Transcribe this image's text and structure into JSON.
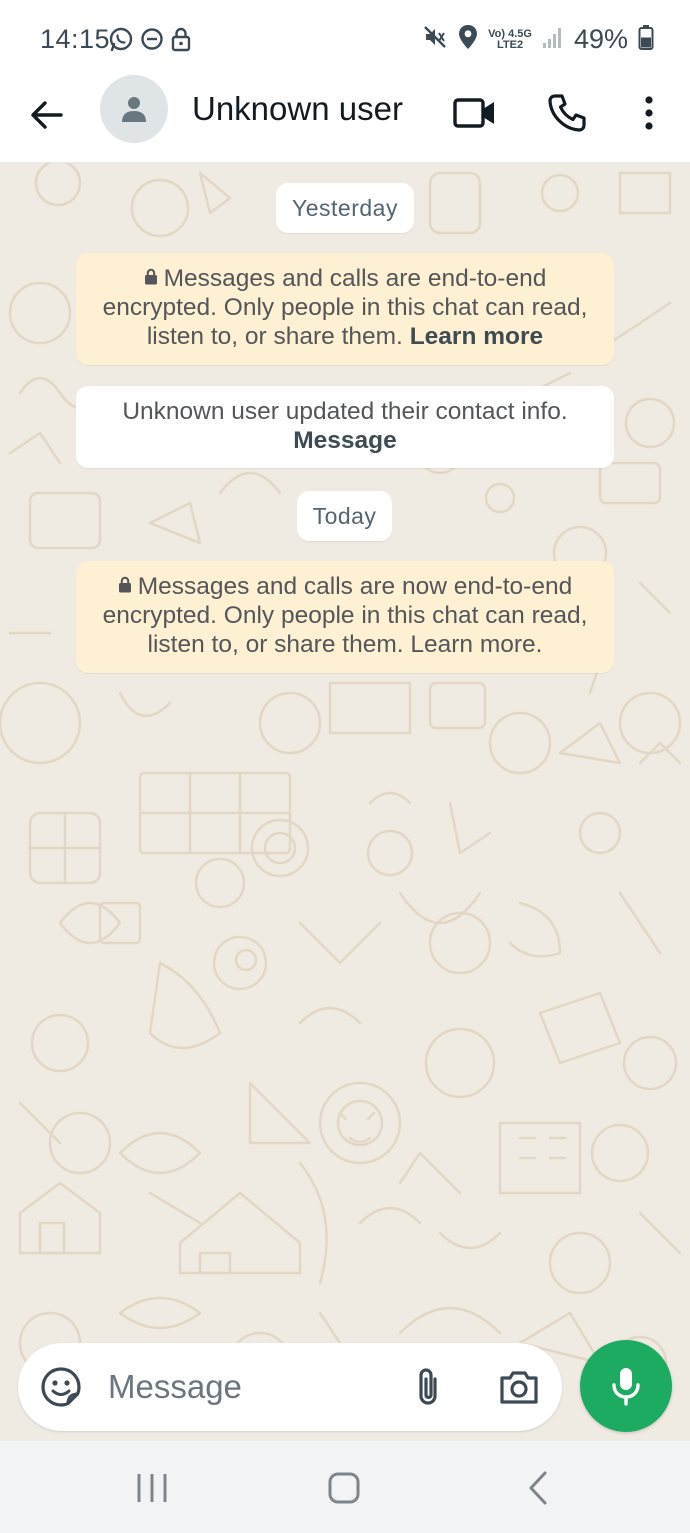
{
  "status_bar": {
    "time": "14:15",
    "battery": "49%",
    "network_top": "Vo) 4.5G",
    "network_bottom": "LTE2",
    "left_icons": [
      "whatsapp-icon",
      "do-not-disturb-icon",
      "lock-icon"
    ],
    "right_icons": [
      "mute-icon",
      "location-icon",
      "signal-icon",
      "battery-icon"
    ]
  },
  "header": {
    "contact_name": "Unknown user",
    "icons": [
      "back-arrow-icon",
      "avatar-icon",
      "video-call-icon",
      "phone-icon",
      "more-vert-icon"
    ]
  },
  "chat": {
    "date_yesterday": "Yesterday",
    "date_today": "Today",
    "encryption_notice_1": {
      "text_line1": "Messages and calls are end-to-end",
      "text_line2": "encrypted. Only people in this chat can read,",
      "text_line3": "listen to, or share them.",
      "link": "Learn more"
    },
    "contact_update": {
      "text": "Unknown user updated their contact info.",
      "link": "Message"
    },
    "encryption_notice_2": {
      "text_line1": "Messages and calls are now end-to-end",
      "text_line2": "encrypted. Only people in this chat can read,",
      "text_line3": "listen to, or share them. Learn more."
    }
  },
  "composer": {
    "placeholder": "Message",
    "icons": [
      "sticker-icon",
      "paperclip-icon",
      "camera-icon",
      "microphone-icon"
    ]
  },
  "colors": {
    "accent_green": "#1daa61",
    "chat_background": "#efeae2",
    "system_yellow": "#fdf0d3"
  },
  "nav_bar": {
    "icons": [
      "recents-icon",
      "home-icon",
      "nav-back-icon"
    ]
  }
}
